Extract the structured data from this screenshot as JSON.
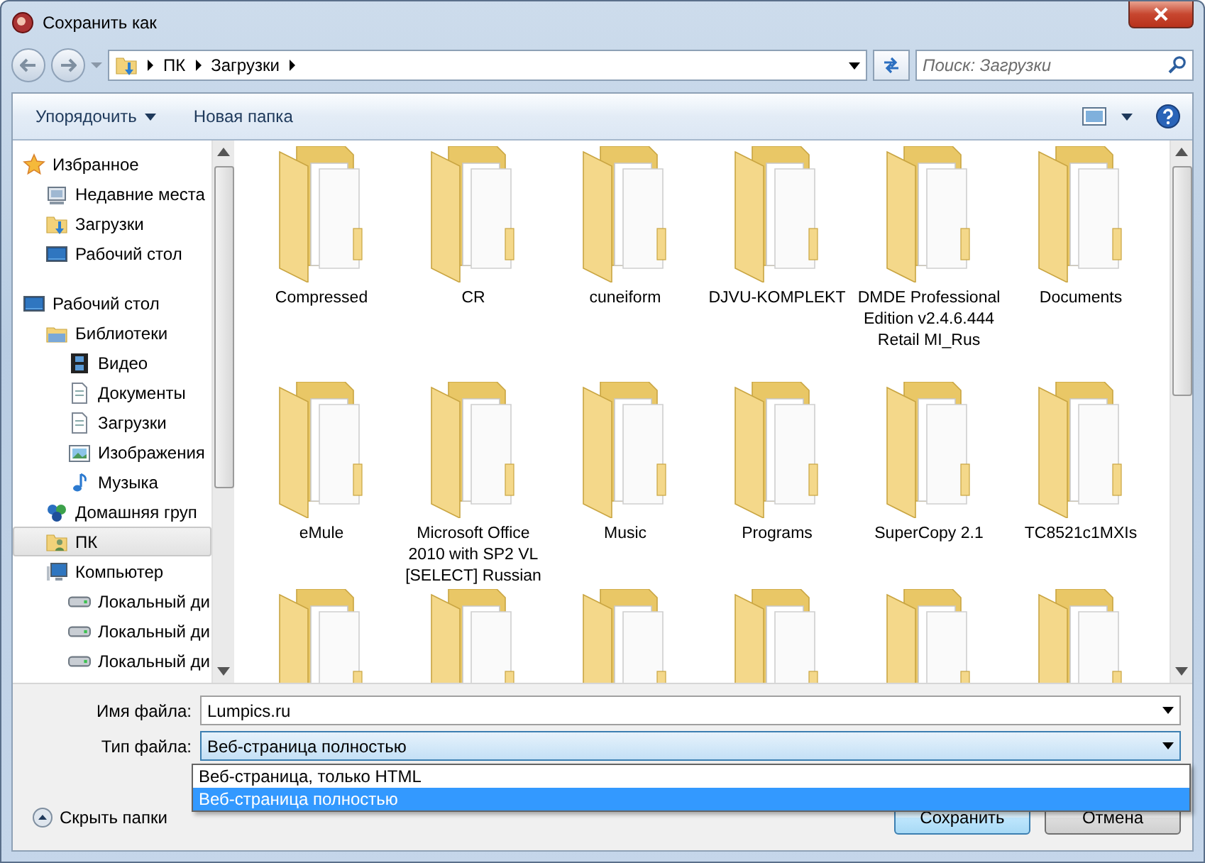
{
  "window": {
    "title": "Сохранить как"
  },
  "address": {
    "path": [
      "ПК",
      "Загрузки"
    ]
  },
  "search": {
    "placeholder": "Поиск: Загрузки"
  },
  "toolbar": {
    "organize": "Упорядочить",
    "new_folder": "Новая папка"
  },
  "sidebar": {
    "groups": [
      {
        "label": "Избранное",
        "kind": "star",
        "selected": false,
        "children": [
          {
            "label": "Недавние места",
            "kind": "recent",
            "selected": false
          },
          {
            "label": "Загрузки",
            "kind": "downloads",
            "selected": false
          },
          {
            "label": "Рабочий стол",
            "kind": "desktop",
            "selected": false
          }
        ]
      },
      {
        "label": "Рабочий стол",
        "kind": "desktop",
        "selected": false,
        "children": [
          {
            "label": "Библиотеки",
            "kind": "library",
            "selected": false,
            "children": [
              {
                "label": "Видео",
                "kind": "video",
                "selected": false
              },
              {
                "label": "Документы",
                "kind": "document",
                "selected": false
              },
              {
                "label": "Загрузки",
                "kind": "document",
                "selected": false
              },
              {
                "label": "Изображения",
                "kind": "image",
                "selected": false
              },
              {
                "label": "Музыка",
                "kind": "music",
                "selected": false
              }
            ]
          },
          {
            "label": "Домашняя груп",
            "kind": "homegroup",
            "selected": false
          },
          {
            "label": "ПК",
            "kind": "pc",
            "selected": true
          },
          {
            "label": "Компьютер",
            "kind": "computer",
            "selected": false,
            "children": [
              {
                "label": "Локальный ди",
                "kind": "disk",
                "selected": false
              },
              {
                "label": "Локальный ди",
                "kind": "disk",
                "selected": false
              },
              {
                "label": "Локальный ди",
                "kind": "disk",
                "selected": false
              }
            ]
          }
        ]
      }
    ]
  },
  "folders": [
    {
      "kind": "folder",
      "name": "Compressed"
    },
    {
      "kind": "folder",
      "name": "CR"
    },
    {
      "kind": "folder",
      "name": "cuneiform"
    },
    {
      "kind": "folder",
      "name": "DJVU-KOMPLEKT"
    },
    {
      "kind": "folder",
      "name": "DMDE Professional Edition v2.4.6.444 Retail MI_Rus"
    },
    {
      "kind": "folder",
      "name": "Documents"
    },
    {
      "kind": "folder",
      "name": "eMule"
    },
    {
      "kind": "folder",
      "name": "Microsoft Office 2010 with SP2 VL [SELECT] Russian"
    },
    {
      "kind": "folder",
      "name": "Music"
    },
    {
      "kind": "folder",
      "name": "Programs"
    },
    {
      "kind": "folder",
      "name": "SuperCopy 2.1"
    },
    {
      "kind": "folder",
      "name": "TC8521c1MXIs"
    },
    {
      "kind": "folder"
    },
    {
      "kind": "folder"
    },
    {
      "kind": "folder"
    },
    {
      "kind": "folder"
    },
    {
      "kind": "folder"
    },
    {
      "kind": "folder"
    }
  ],
  "file_name": {
    "label": "Имя файла:",
    "value": "Lumpics.ru"
  },
  "file_type": {
    "label": "Тип файла:",
    "value": "Веб-страница полностью",
    "expanded": true,
    "options": [
      {
        "label": "Веб-страница, только HTML",
        "selected": false
      },
      {
        "label": "Веб-страница полностью",
        "selected": true
      }
    ]
  },
  "hide_folders": "Скрыть папки",
  "buttons": [
    {
      "label": "Сохранить",
      "default": true
    },
    {
      "label": "Отмена",
      "default": false
    }
  ]
}
